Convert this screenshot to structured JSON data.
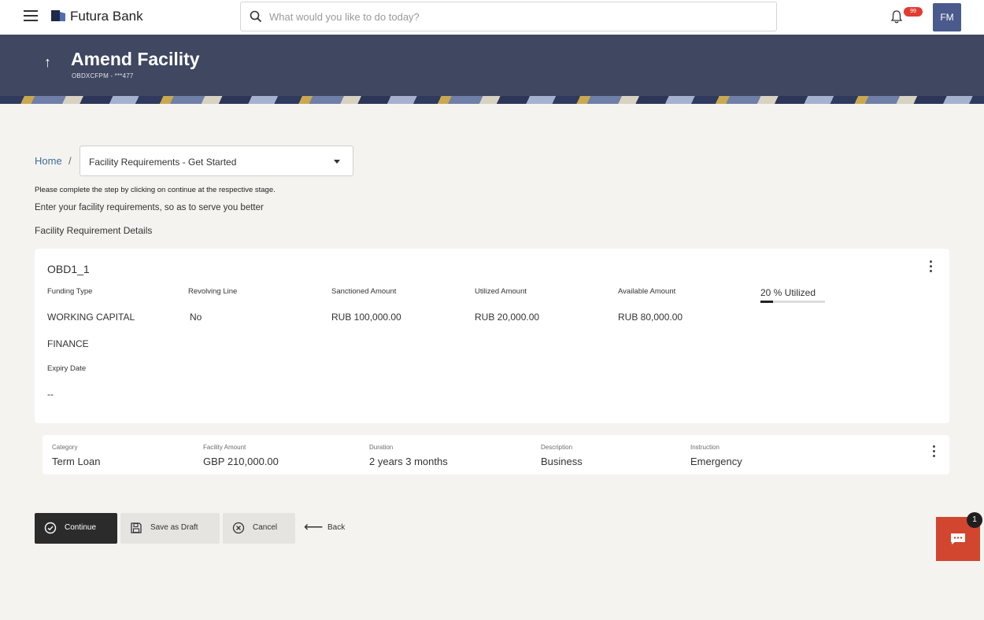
{
  "topbar": {
    "brand": "Futura Bank",
    "search_placeholder": "What would you like to do today?",
    "notification_badge": "99",
    "avatar_initials": "FM"
  },
  "header": {
    "title": "Amend Facility",
    "subtitle": "OBDXCFPM - ***477"
  },
  "breadcrumb": {
    "home": "Home",
    "separator": "/",
    "current": "Facility Requirements - Get Started"
  },
  "instructions": {
    "line1": "Please complete the step by clicking on continue at the respective stage.",
    "line2": "Enter your facility requirements, so as to serve you better"
  },
  "section_title": "Facility Requirement Details",
  "facility": {
    "id": "OBD1_1",
    "funding_type_label": "Funding Type",
    "funding_type_line1": "WORKING CAPITAL",
    "funding_type_line2": "FINANCE",
    "revolving_label": "Revolving Line",
    "revolving_value": "No",
    "sanctioned_label": "Sanctioned Amount",
    "sanctioned_value": "RUB 100,000.00",
    "utilized_label": "Utilized Amount",
    "utilized_value": "RUB 20,000.00",
    "available_label": "Available Amount",
    "available_value": "RUB 80,000.00",
    "utilization_text": "20 % Utilized",
    "utilization_fraction": 0.2,
    "expiry_label": "Expiry Date",
    "expiry_value": "--"
  },
  "requirement_row": {
    "category_label": "Category",
    "category_value": "Term Loan",
    "amount_label": "Facility Amount",
    "amount_value": "GBP 210,000.00",
    "duration_label": "Duration",
    "duration_value": "2 years 3 months",
    "description_label": "Description",
    "description_value": "Business",
    "instruction_label": "Instruction",
    "instruction_value": "Emergency"
  },
  "actions": {
    "continue": "Continue",
    "save_draft": "Save as Draft",
    "cancel": "Cancel",
    "back": "Back"
  },
  "chat": {
    "badge": "1"
  },
  "colors": {
    "header_bg": "#3f4761",
    "primary_button": "#2b2b2b",
    "chat_widget": "#d2452f",
    "link": "#3d6b9c"
  }
}
